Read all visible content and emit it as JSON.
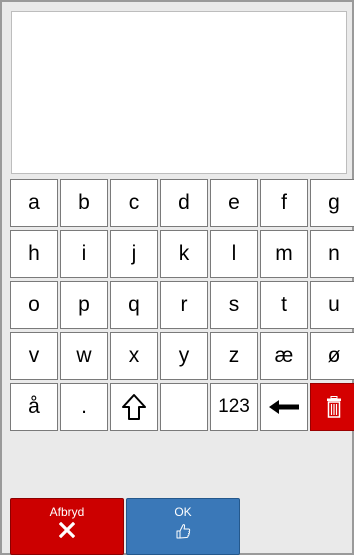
{
  "keyboard": {
    "rows": [
      [
        "a",
        "b",
        "c",
        "d",
        "e",
        "f",
        "g"
      ],
      [
        "h",
        "i",
        "j",
        "k",
        "l",
        "m",
        "n"
      ],
      [
        "o",
        "p",
        "q",
        "r",
        "s",
        "t",
        "u"
      ],
      [
        "v",
        "w",
        "x",
        "y",
        "z",
        "æ",
        "ø"
      ],
      [
        "å",
        ".",
        "",
        "",
        "123",
        "",
        ""
      ]
    ]
  },
  "icons": {
    "shift": "shift-icon",
    "backspace": "backspace-icon",
    "trash": "trash-icon"
  },
  "actions": {
    "cancel_label": "Afbryd",
    "ok_label": "OK"
  },
  "colors": {
    "cancel": "#cc0000",
    "ok": "#3a78b8",
    "trash": "#d40000"
  }
}
